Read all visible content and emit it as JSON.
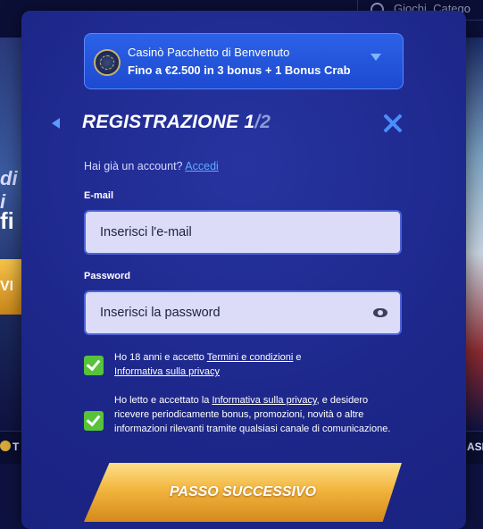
{
  "background": {
    "search_label": "Giochi, Catego",
    "left_text_1": "di i",
    "left_text_2": "fi",
    "left_button": "VI",
    "strip_left": "T",
    "strip_right": "ASI"
  },
  "bonus": {
    "title": "Casinò Pacchetto di Benvenuto",
    "subtitle": "Fino a €2.500 in 3 bonus + 1 Bonus Crab"
  },
  "header": {
    "title": "REGISTRAZIONE",
    "step": "1",
    "separator": "/",
    "total": "2"
  },
  "account": {
    "prompt": "Hai già un account?",
    "login_link": "Accedi"
  },
  "email": {
    "label": "E-mail",
    "placeholder": "Inserisci l'e-mail",
    "value": ""
  },
  "password": {
    "label": "Password",
    "placeholder": "Inserisci la password",
    "value": ""
  },
  "consent1": {
    "checked": true,
    "text_a": "Ho 18 anni e accetto ",
    "link1": "Termini e condizioni",
    "text_b": " e",
    "link2": "Informativa sulla privacy"
  },
  "consent2": {
    "checked": true,
    "text_a": "Ho letto e accettato la ",
    "link": "Informativa sulla privacy",
    "text_b": ", e desidero ricevere periodicamente bonus, promozioni, novità o altre informazioni rilevanti tramite qualsiasi canale di comunicazione."
  },
  "next_button": "PASSO SUCCESSIVO",
  "colors": {
    "modal": "#1f2a8c",
    "accent": "#4a8dff",
    "check": "#57c23a",
    "button": "#f2b53e"
  }
}
